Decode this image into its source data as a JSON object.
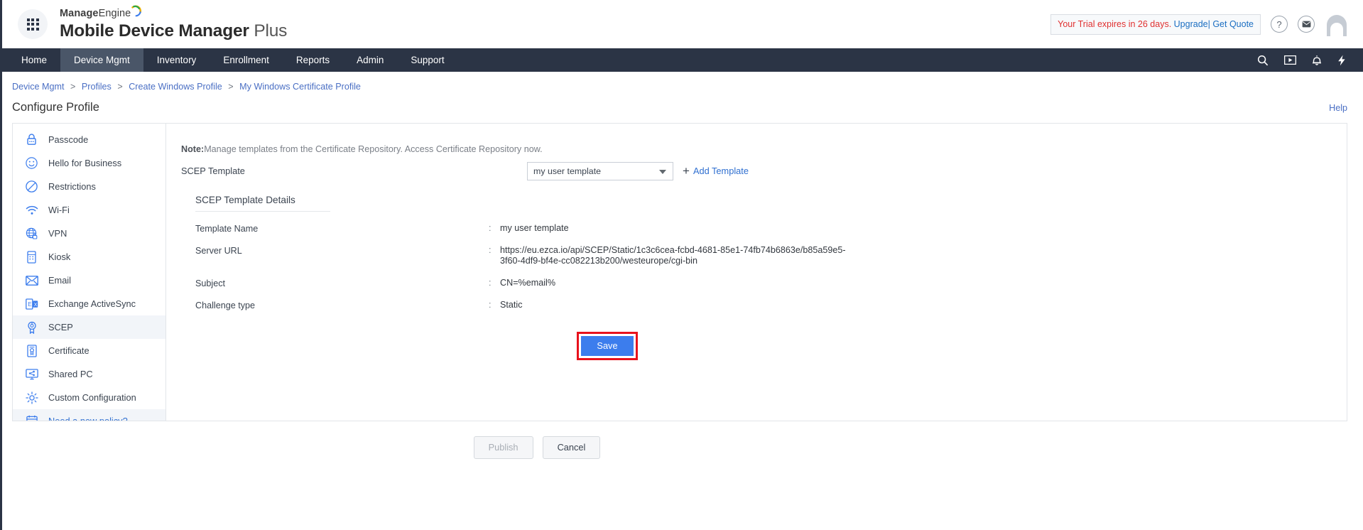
{
  "header": {
    "logo_icon": "app-grid-icon",
    "brand_top_bold": "Manage",
    "brand_top_light": "Engine",
    "brand_bottom_bold": "Mobile Device Manager",
    "brand_bottom_light": "Plus",
    "trial_red": "Your Trial expires in 26 days.",
    "trial_link": "Upgrade| Get Quote",
    "help_icon_label": "?",
    "mail_icon_label": "✉",
    "avatar_label": "user-avatar"
  },
  "nav": {
    "items": [
      {
        "label": "Home",
        "active": false
      },
      {
        "label": "Device Mgmt",
        "active": true
      },
      {
        "label": "Inventory",
        "active": false
      },
      {
        "label": "Enrollment",
        "active": false
      },
      {
        "label": "Reports",
        "active": false
      },
      {
        "label": "Admin",
        "active": false
      },
      {
        "label": "Support",
        "active": false
      }
    ],
    "icons": [
      "search-icon",
      "video-tutorial-icon",
      "notification-bell-icon",
      "quick-actions-bolt-icon"
    ]
  },
  "breadcrumb": {
    "items": [
      "Device Mgmt",
      "Profiles",
      "Create Windows Profile",
      "My Windows Certificate Profile"
    ],
    "separator": ">"
  },
  "page": {
    "title": "Configure Profile",
    "help_label": "Help"
  },
  "sidebar": {
    "items": [
      {
        "label": "Passcode",
        "icon": "lock-icon",
        "active": false,
        "link": false
      },
      {
        "label": "Hello for Business",
        "icon": "smiley-face-icon",
        "active": false,
        "link": false
      },
      {
        "label": "Restrictions",
        "icon": "no-entry-icon",
        "active": false,
        "link": false
      },
      {
        "label": "Wi-Fi",
        "icon": "wifi-icon",
        "active": false,
        "link": false
      },
      {
        "label": "VPN",
        "icon": "globe-lock-icon",
        "active": false,
        "link": false
      },
      {
        "label": "Kiosk",
        "icon": "kiosk-device-icon",
        "active": false,
        "link": false
      },
      {
        "label": "Email",
        "icon": "envelope-icon",
        "active": false,
        "link": false
      },
      {
        "label": "Exchange ActiveSync",
        "icon": "exchange-icon",
        "active": false,
        "link": false
      },
      {
        "label": "SCEP",
        "icon": "certificate-seal-icon",
        "active": true,
        "link": false
      },
      {
        "label": "Certificate",
        "icon": "certificate-doc-icon",
        "active": false,
        "link": false
      },
      {
        "label": "Shared PC",
        "icon": "shared-pc-icon",
        "active": false,
        "link": false
      },
      {
        "label": "Custom Configuration",
        "icon": "gear-icon",
        "active": false,
        "link": false
      },
      {
        "label": "Need a new policy?",
        "icon": "calendar-icon",
        "active": false,
        "link": true
      }
    ]
  },
  "main": {
    "note_bold": "Note:",
    "note_text": "Manage templates from the Certificate Repository. Access Certificate Repository now.",
    "scep_template_label": "SCEP Template",
    "scep_template_value": "my user template",
    "add_template_label": "Add Template",
    "details_title": "SCEP Template Details",
    "details": [
      {
        "key": "Template Name",
        "value": "my user template"
      },
      {
        "key": "Server URL",
        "value": "https://eu.ezca.io/api/SCEP/Static/1c3c6cea-fcbd-4681-85e1-74fb74b6863e/b85a59e5-3f60-4df9-bf4e-cc082213b200/westeurope/cgi-bin"
      },
      {
        "key": "Subject",
        "value": "CN=%email%"
      },
      {
        "key": "Challenge type",
        "value": "Static"
      }
    ],
    "colon": ":",
    "save_label": "Save"
  },
  "footer": {
    "publish_label": "Publish",
    "cancel_label": "Cancel"
  },
  "colors": {
    "nav_bg": "#2b3445",
    "nav_active": "#4a5668",
    "link_blue": "#2f6fd0",
    "trial_red": "#e03131",
    "save_blue": "#3c7ded",
    "highlight_red": "#e8121c"
  }
}
